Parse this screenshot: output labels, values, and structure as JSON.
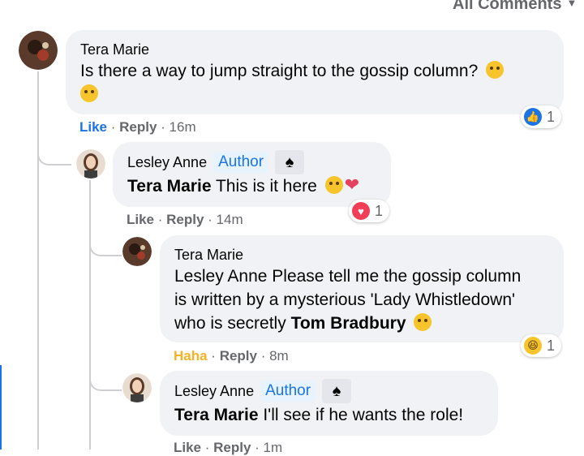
{
  "header": {
    "all_comments_label": "All Comments"
  },
  "comments": [
    {
      "author": "Tera Marie",
      "text": "Is there a way to jump straight to the gossip column?",
      "actions": {
        "like": "Like",
        "reply": "Reply",
        "time": "16m"
      },
      "reaction": {
        "type": "like",
        "count": "1"
      },
      "emojis": [
        "winking-face-emoji",
        "laughing-face-emoji"
      ]
    },
    {
      "author": "Lesley Anne",
      "badge": "Author",
      "badge_icon": "spade-icon",
      "mention": "Tera Marie",
      "text": "This is it here",
      "actions": {
        "like": "Like",
        "reply": "Reply",
        "time": "14m"
      },
      "reaction": {
        "type": "love",
        "count": "1"
      },
      "emojis": [
        "winking-face-emoji",
        "heart-emoji"
      ]
    },
    {
      "author": "Tera Marie",
      "mention_lead": "Lesley Anne",
      "text_line1": "Please tell me the gossip column",
      "text_line2": "is written by a mysterious 'Lady Whistledown'",
      "text_line3_pre": "who is secretly",
      "mention_bold": "Tom Bradbury",
      "actions": {
        "like": "Haha",
        "reply": "Reply",
        "time": "8m"
      },
      "reaction": {
        "type": "haha",
        "count": "1"
      },
      "emojis": [
        "grinning-face-emoji"
      ]
    },
    {
      "author": "Lesley Anne",
      "badge": "Author",
      "badge_icon": "spade-icon",
      "mention": "Tera Marie",
      "text": "I'll see if he wants the role!",
      "actions": {
        "like": "Like",
        "reply": "Reply",
        "time": "1m"
      }
    }
  ],
  "colors": {
    "link_blue": "#1b74e4",
    "haha_yellow": "#f7b125",
    "bubble_bg": "#f0f2f5",
    "meta_gray": "#65676b"
  }
}
